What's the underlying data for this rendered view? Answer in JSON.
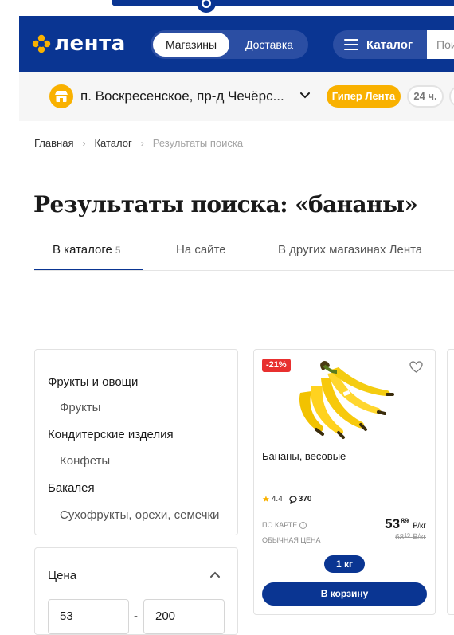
{
  "header": {
    "logo_text": "лента",
    "segment": {
      "active": "Магазины",
      "inactive": "Доставка"
    },
    "catalog_label": "Каталог",
    "search_placeholder": "Пои"
  },
  "store": {
    "address": "п. Воскресенское, пр-д Чечёрс...",
    "format_badge": "Гипер Лента",
    "hours_badge": "24 ч."
  },
  "breadcrumbs": [
    "Главная",
    "Каталог",
    "Результаты поиска"
  ],
  "page_title": "Результаты поиска: «бананы»",
  "tabs": [
    {
      "label": "В каталоге",
      "count": "5"
    },
    {
      "label": "На сайте"
    },
    {
      "label": "В других магазинах Лента"
    }
  ],
  "categories": [
    {
      "name": "Фрукты и овощи",
      "sub": "Фрукты"
    },
    {
      "name": "Кондитерские изделия",
      "sub": "Конфеты"
    },
    {
      "name": "Бакалея",
      "sub": "Сухофрукты, орехи, семечки"
    }
  ],
  "price_filter": {
    "title": "Цена",
    "min": "53",
    "max": "200",
    "separator": "-"
  },
  "product": {
    "discount": "-21%",
    "name": "Бананы, весовые",
    "rating": "4.4",
    "reviews": "370",
    "card_price_label": "ПО КАРТЕ",
    "regular_price_label": "ОБЫЧНАЯ ЦЕНА",
    "price_rub": "53",
    "price_kop": "89",
    "price_unit": "₽/кг",
    "old_price_rub": "68",
    "old_price_kop": "19",
    "old_price_unit": "₽/кг",
    "weight": "1 кг",
    "cart_label": "В корзину"
  },
  "colors": {
    "brand_blue": "#0a3592",
    "accent_yellow": "#f9b100",
    "discount_red": "#e8302f"
  }
}
